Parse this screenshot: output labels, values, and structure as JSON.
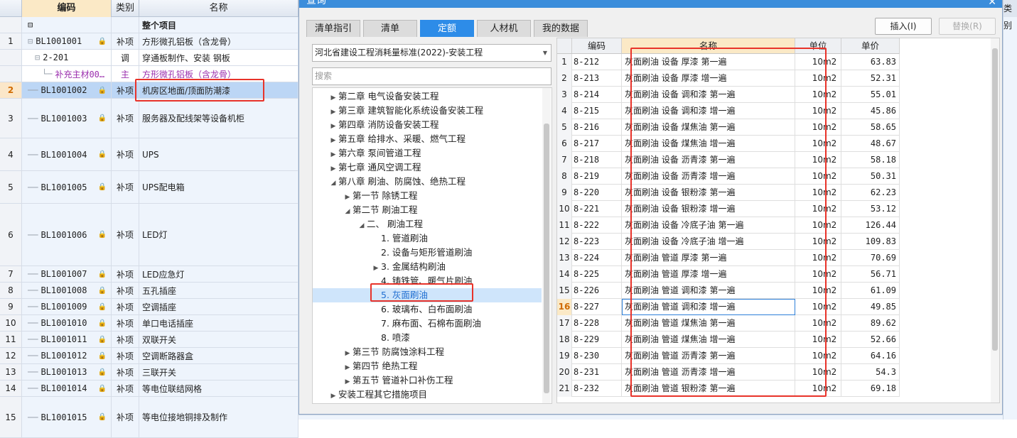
{
  "main_grid": {
    "headers": {
      "code": "编码",
      "type": "类别",
      "name": "名称",
      "right_type": "类别"
    },
    "whole_project_label": "整个项目",
    "rows": [
      {
        "no": "1",
        "code": "BL1001001",
        "type": "补项",
        "name": "方形微孔铝板（含龙骨）"
      },
      {
        "no": "",
        "code": "2-201",
        "type": "调",
        "name": "穿通板制作、安装 钢板"
      },
      {
        "no": "",
        "code": "补充主材00…",
        "type": "主",
        "name": "方形微孔铝板（含龙骨）"
      },
      {
        "no": "2",
        "code": "BL1001002",
        "type": "补项",
        "name": "机房区地面/顶面防潮漆"
      },
      {
        "no": "3",
        "code": "BL1001003",
        "type": "补项",
        "name": "服务器及配线架等设备机柜"
      },
      {
        "no": "4",
        "code": "BL1001004",
        "type": "补项",
        "name": "UPS"
      },
      {
        "no": "5",
        "code": "BL1001005",
        "type": "补项",
        "name": "UPS配电箱"
      },
      {
        "no": "6",
        "code": "BL1001006",
        "type": "补项",
        "name": "LED灯"
      },
      {
        "no": "7",
        "code": "BL1001007",
        "type": "补项",
        "name": "LED应急灯"
      },
      {
        "no": "8",
        "code": "BL1001008",
        "type": "补项",
        "name": "五孔插座"
      },
      {
        "no": "9",
        "code": "BL1001009",
        "type": "补项",
        "name": "空调插座"
      },
      {
        "no": "10",
        "code": "BL1001010",
        "type": "补项",
        "name": "单口电话插座"
      },
      {
        "no": "11",
        "code": "BL1001011",
        "type": "补项",
        "name": "双联开关"
      },
      {
        "no": "12",
        "code": "BL1001012",
        "type": "补项",
        "name": "空调断路器盒"
      },
      {
        "no": "13",
        "code": "BL1001013",
        "type": "补项",
        "name": "三联开关"
      },
      {
        "no": "14",
        "code": "BL1001014",
        "type": "补项",
        "name": "等电位联结网格"
      },
      {
        "no": "15",
        "code": "BL1001015",
        "type": "补项",
        "name": "等电位接地铜排及制作"
      }
    ]
  },
  "dialog": {
    "title": "查询",
    "tabs": [
      "清单指引",
      "清单",
      "定额",
      "人材机",
      "我的数据"
    ],
    "active_tab": "定额",
    "insert_button": "插入(I)",
    "replace_button": "替换(R)",
    "library": "河北省建设工程消耗量标准(2022)-安装工程",
    "search_placeholder": "搜索",
    "tree": [
      {
        "label": "第二章 电气设备安装工程",
        "level": 0,
        "toggle": "▶"
      },
      {
        "label": "第三章 建筑智能化系统设备安装工程",
        "level": 0,
        "toggle": "▶"
      },
      {
        "label": "第四章 消防设备安装工程",
        "level": 0,
        "toggle": "▶"
      },
      {
        "label": "第五章 给排水、采暖、燃气工程",
        "level": 0,
        "toggle": "▶"
      },
      {
        "label": "第六章 泵间管道工程",
        "level": 0,
        "toggle": "▶"
      },
      {
        "label": "第七章 通风空调工程",
        "level": 0,
        "toggle": "▶"
      },
      {
        "label": "第八章 刷油、防腐蚀、绝热工程",
        "level": 0,
        "toggle": "◢"
      },
      {
        "label": "第一节 除锈工程",
        "level": 1,
        "toggle": "▶"
      },
      {
        "label": "第二节 刷油工程",
        "level": 1,
        "toggle": "◢"
      },
      {
        "label": "二、 刷油工程",
        "level": 2,
        "toggle": "◢"
      },
      {
        "label": "1. 管道刷油",
        "level": 3,
        "toggle": ""
      },
      {
        "label": "2. 设备与矩形管道刷油",
        "level": 3,
        "toggle": ""
      },
      {
        "label": "3. 金属结构刷油",
        "level": 3,
        "toggle": "▶"
      },
      {
        "label": "4. 铸铁管、暖气片刷油",
        "level": 3,
        "toggle": ""
      },
      {
        "label": "5. 灰面刷油",
        "level": 3,
        "toggle": "",
        "selected": true
      },
      {
        "label": "6. 玻璃布、白布面刷油",
        "level": 3,
        "toggle": ""
      },
      {
        "label": "7. 麻布面、石棉布面刷油",
        "level": 3,
        "toggle": ""
      },
      {
        "label": "8. 喷漆",
        "level": 3,
        "toggle": ""
      },
      {
        "label": "第三节 防腐蚀涂料工程",
        "level": 1,
        "toggle": "▶"
      },
      {
        "label": "第四节 绝热工程",
        "level": 1,
        "toggle": "▶"
      },
      {
        "label": "第五节 管道补口补伤工程",
        "level": 1,
        "toggle": "▶"
      },
      {
        "label": "安装工程其它措施项目",
        "level": 0,
        "toggle": "▶"
      }
    ],
    "table": {
      "headers": {
        "code": "编码",
        "name": "名称",
        "unit": "单位",
        "price": "单价"
      },
      "rows": [
        {
          "no": "1",
          "code": "8-212",
          "name": "灰面刷油 设备 厚漆 第一遍",
          "unit": "10m2",
          "price": "63.83"
        },
        {
          "no": "2",
          "code": "8-213",
          "name": "灰面刷油 设备 厚漆 增一遍",
          "unit": "10m2",
          "price": "52.31"
        },
        {
          "no": "3",
          "code": "8-214",
          "name": "灰面刷油 设备 调和漆 第一遍",
          "unit": "10m2",
          "price": "55.01"
        },
        {
          "no": "4",
          "code": "8-215",
          "name": "灰面刷油 设备 调和漆 增一遍",
          "unit": "10m2",
          "price": "45.86"
        },
        {
          "no": "5",
          "code": "8-216",
          "name": "灰面刷油 设备 煤焦油 第一遍",
          "unit": "10m2",
          "price": "58.65"
        },
        {
          "no": "6",
          "code": "8-217",
          "name": "灰面刷油 设备 煤焦油 增一遍",
          "unit": "10m2",
          "price": "48.67"
        },
        {
          "no": "7",
          "code": "8-218",
          "name": "灰面刷油 设备 沥青漆 第一遍",
          "unit": "10m2",
          "price": "58.18"
        },
        {
          "no": "8",
          "code": "8-219",
          "name": "灰面刷油 设备 沥青漆 增一遍",
          "unit": "10m2",
          "price": "50.31"
        },
        {
          "no": "9",
          "code": "8-220",
          "name": "灰面刷油 设备 银粉漆 第一遍",
          "unit": "10m2",
          "price": "62.23"
        },
        {
          "no": "10",
          "code": "8-221",
          "name": "灰面刷油 设备 银粉漆 增一遍",
          "unit": "10m2",
          "price": "53.12"
        },
        {
          "no": "11",
          "code": "8-222",
          "name": "灰面刷油 设备 冷底子油 第一遍",
          "unit": "10m2",
          "price": "126.44"
        },
        {
          "no": "12",
          "code": "8-223",
          "name": "灰面刷油 设备 冷底子油 增一遍",
          "unit": "10m2",
          "price": "109.83"
        },
        {
          "no": "13",
          "code": "8-224",
          "name": "灰面刷油 管道 厚漆 第一遍",
          "unit": "10m2",
          "price": "70.69"
        },
        {
          "no": "14",
          "code": "8-225",
          "name": "灰面刷油 管道 厚漆 增一遍",
          "unit": "10m2",
          "price": "56.71"
        },
        {
          "no": "15",
          "code": "8-226",
          "name": "灰面刷油 管道 调和漆 第一遍",
          "unit": "10m2",
          "price": "61.09"
        },
        {
          "no": "16",
          "code": "8-227",
          "name": "灰面刷油 管道 调和漆 增一遍",
          "unit": "10m2",
          "price": "49.85"
        },
        {
          "no": "17",
          "code": "8-228",
          "name": "灰面刷油 管道 煤焦油 第一遍",
          "unit": "10m2",
          "price": "89.62"
        },
        {
          "no": "18",
          "code": "8-229",
          "name": "灰面刷油 管道 煤焦油 增一遍",
          "unit": "10m2",
          "price": "52.66"
        },
        {
          "no": "19",
          "code": "8-230",
          "name": "灰面刷油 管道 沥青漆 第一遍",
          "unit": "10m2",
          "price": "64.16"
        },
        {
          "no": "20",
          "code": "8-231",
          "name": "灰面刷油 管道 沥青漆 增一遍",
          "unit": "10m2",
          "price": "54.3"
        },
        {
          "no": "21",
          "code": "8-232",
          "name": "灰面刷油 管道 银粉漆 第一遍",
          "unit": "10m2",
          "price": "69.18"
        }
      ]
    }
  },
  "colors": {
    "accent": "#2d8ce8",
    "highlight_red": "#e8332a",
    "selected_row": "#bcd6f5"
  }
}
